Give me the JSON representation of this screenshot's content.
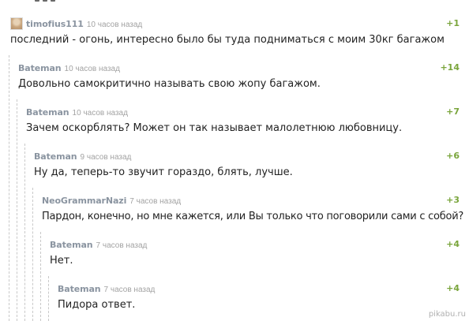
{
  "comments": [
    {
      "author": "timofius111",
      "time": "10 часов назад",
      "rating": "+1",
      "text": "последний - огонь, интересно было бы туда подниматься с моим 30кг багажом"
    },
    {
      "author": "Bateman",
      "time": "10 часов назад",
      "rating": "+14",
      "text": "Довольно самокритично называть свою жопу багажом."
    },
    {
      "author": "Bateman",
      "time": "10 часов назад",
      "rating": "+7",
      "text": "Зачем оскорблять? Может он так называет малолетнюю любовницу."
    },
    {
      "author": "Bateman",
      "time": "9 часов назад",
      "rating": "+6",
      "text": "Ну да, теперь-то звучит гораздо, блять, лучше."
    },
    {
      "author": "NeoGrammarNazi",
      "time": "7 часов назад",
      "rating": "+3",
      "text": "Пардон, конечно, но мне кажется, или Вы только что поговорили сами с собой?"
    },
    {
      "author": "Bateman",
      "time": "7 часов назад",
      "rating": "+4",
      "text": "Нет."
    },
    {
      "author": "Bateman",
      "time": "7 часов назад",
      "rating": "+4",
      "text": "Пидора ответ."
    }
  ],
  "watermark": "pikabu.ru"
}
